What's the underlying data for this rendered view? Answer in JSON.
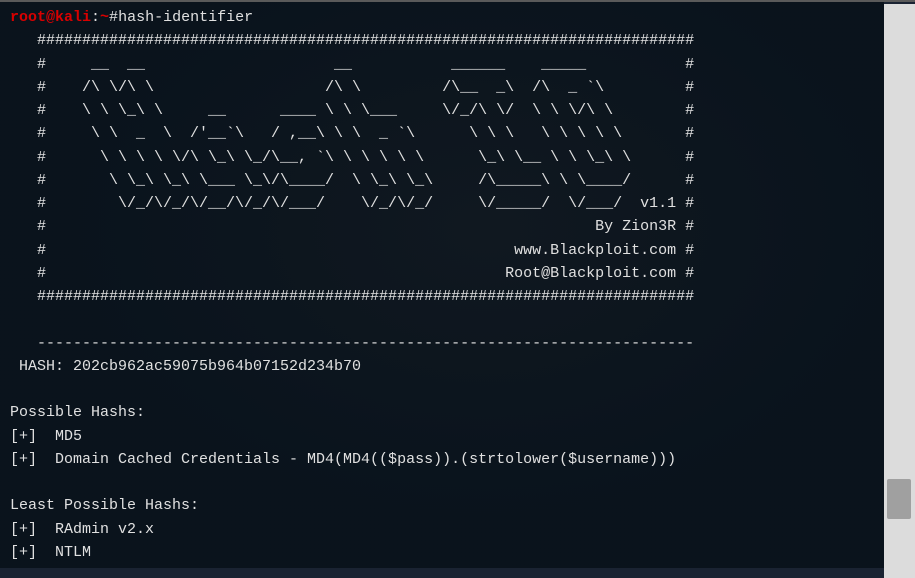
{
  "prompt": {
    "user_host": "root@kali",
    "separator": ":",
    "path": "~",
    "hash": "# ",
    "command": "hash-identifier"
  },
  "banner": {
    "line0": "   #########################################################################",
    "line1": "   #     __  __                     __           ______    _____           #",
    "line2": "   #    /\\ \\/\\ \\                   /\\ \\         /\\__  _\\  /\\  _ `\\         #",
    "line3": "   #    \\ \\ \\_\\ \\     __      ____ \\ \\ \\___     \\/_/\\ \\/  \\ \\ \\/\\ \\        #",
    "line4": "   #     \\ \\  _  \\  /'__`\\   / ,__\\ \\ \\  _ `\\      \\ \\ \\   \\ \\ \\ \\ \\       #",
    "line5": "   #      \\ \\ \\ \\ \\/\\ \\_\\ \\_/\\__, `\\ \\ \\ \\ \\ \\      \\_\\ \\__ \\ \\ \\_\\ \\      #",
    "line6": "   #       \\ \\_\\ \\_\\ \\___ \\_\\/\\____/  \\ \\_\\ \\_\\     /\\_____\\ \\ \\____/      #",
    "line7": "   #        \\/_/\\/_/\\/__/\\/_/\\/___/    \\/_/\\/_/     \\/_____/  \\/___/  v1.1 #",
    "line8": "   #                                                             By Zion3R #",
    "line9": "   #                                                    www.Blackploit.com #",
    "line10": "   #                                                   Root@Blackploit.com #",
    "line11": "   #########################################################################",
    "line12": "   -------------------------------------------------------------------------"
  },
  "input": {
    "hash_prompt": " HASH: ",
    "hash_value": "202cb962ac59075b964b07152d234b70"
  },
  "possible": {
    "header": "Possible Hashs:",
    "items": [
      "[+]  MD5",
      "[+]  Domain Cached Credentials - MD4(MD4(($pass)).(strtolower($username)))"
    ]
  },
  "least_possible": {
    "header": "Least Possible Hashs:",
    "items": [
      "[+]  RAdmin v2.x",
      "[+]  NTLM"
    ]
  }
}
